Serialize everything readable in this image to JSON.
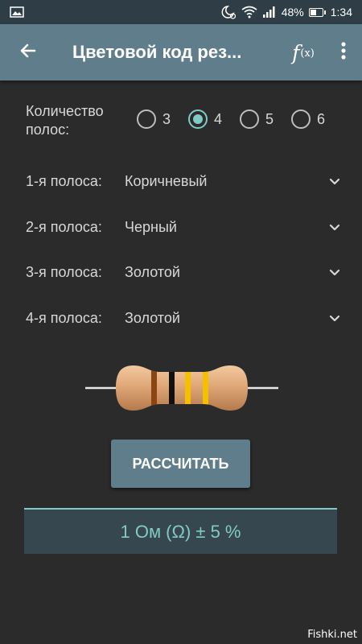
{
  "status_bar": {
    "battery": "48%",
    "time": "1:34",
    "icons": [
      "image-icon",
      "moon-alarm-icon",
      "wifi-icon",
      "signal-icon",
      "battery-icon"
    ]
  },
  "app_bar": {
    "title": "Цветовой код рез...",
    "fx_f": "f",
    "fx_x": "(x)",
    "icons": [
      "back-arrow-icon",
      "function-icon",
      "more-vert-icon"
    ],
    "color": "#607d8b"
  },
  "bands_count": {
    "label": "Количество полос:",
    "options": [
      "3",
      "4",
      "5",
      "6"
    ],
    "selected": "4"
  },
  "bands": [
    {
      "label": "1-я полоса:",
      "value": "Коричневый"
    },
    {
      "label": "2-я полоса:",
      "value": "Черный"
    },
    {
      "label": "3-я полоса:",
      "value": "Золотой"
    },
    {
      "label": "4-я полоса:",
      "value": "Золотой"
    }
  ],
  "resistor": {
    "band_colors": [
      "#8b4513",
      "#111111",
      "#f5c000",
      "#f5c000"
    ]
  },
  "calculate_button": "РАССЧИТАТЬ",
  "result": "1 Ом (Ω) ± 5 %",
  "watermark": "Fishki.net",
  "colors": {
    "accent": "#80cbc4",
    "primary": "#607d8b",
    "background": "#2b2b2b"
  }
}
